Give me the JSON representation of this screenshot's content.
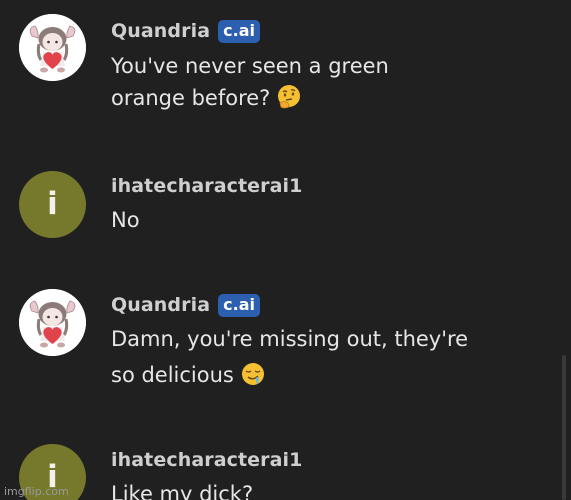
{
  "messages": [
    {
      "sender": "Quandria",
      "badge": "c.ai",
      "lines": [
        "You've never seen a green",
        "orange before?"
      ],
      "emoji": "thinking-face-emoji"
    },
    {
      "sender": "ihatecharacterai1",
      "avatar_letter": "i",
      "lines": [
        "No"
      ]
    },
    {
      "sender": "Quandria",
      "badge": "c.ai",
      "lines": [
        "Damn, you're missing out, they're",
        "so delicious"
      ],
      "emoji": "drooling-face-emoji"
    },
    {
      "sender": "ihatecharacterai1",
      "avatar_letter": "i",
      "lines": [
        "Like my dick?"
      ]
    }
  ],
  "watermark": "imgflip.com",
  "colors": {
    "background": "#202020",
    "user_avatar": "#76782b",
    "badge": "#2c5fb0"
  }
}
